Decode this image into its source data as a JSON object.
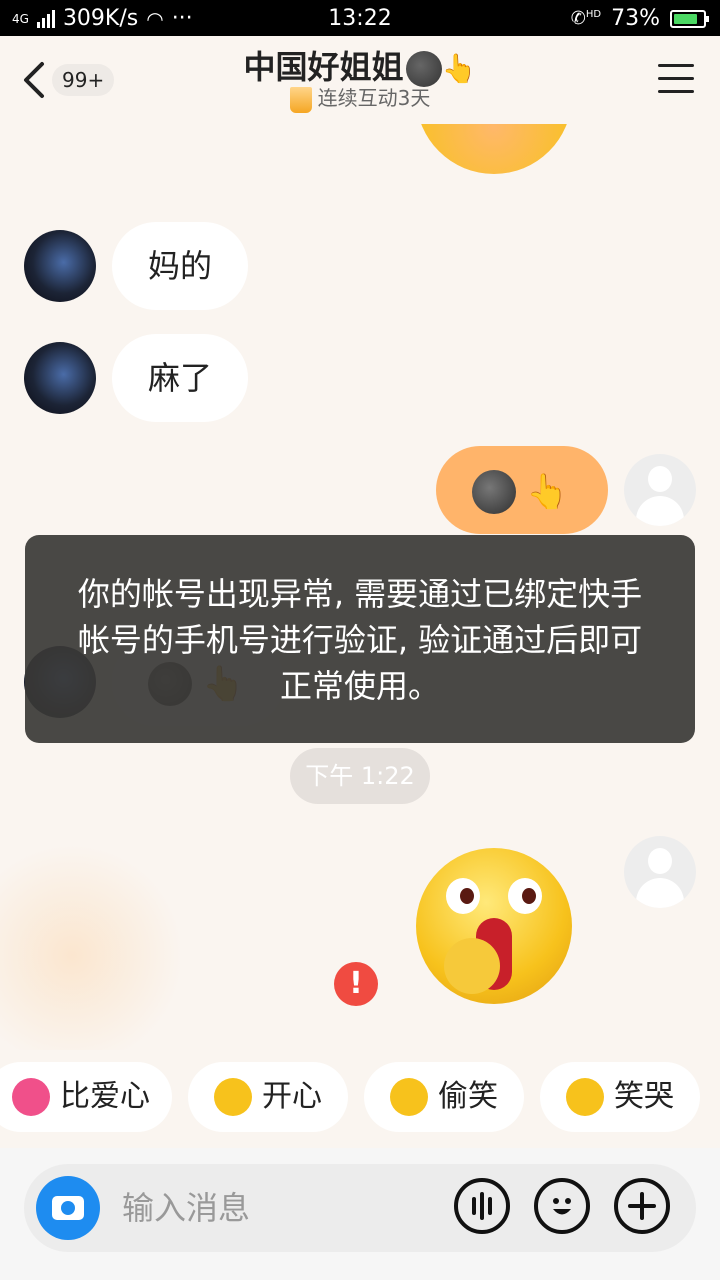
{
  "status_bar": {
    "network": "4G",
    "speed": "309K/s",
    "more": "···",
    "time": "13:22",
    "hd": "HD",
    "battery_percent": "73%",
    "battery_level": 0.73
  },
  "header": {
    "unread_count": "99+",
    "title": "中国好姐姐",
    "title_emoji_hand": "👆",
    "streak_label": "连续互动3天"
  },
  "messages": [
    {
      "sender": "other",
      "text": "妈的"
    },
    {
      "sender": "other",
      "text": "麻了"
    },
    {
      "sender": "me",
      "emoji": [
        "new-moon-face",
        "pointing-up"
      ],
      "hand": "👆"
    },
    {
      "sender": "other",
      "emoji": [
        "new-moon-face",
        "pointing-up"
      ],
      "hand": "👆"
    }
  ],
  "toast": {
    "text": "你的帐号出现异常, 需要通过已绑定快手帐号的手机号进行验证, 验证通过后即可正常使用。"
  },
  "timestamp": "下午 1:22",
  "send_failed_mark": "!",
  "quick_replies": [
    {
      "label": "比爱心",
      "icon": "heart-icon",
      "color": "#f0508a"
    },
    {
      "label": "开心",
      "icon": "laughing-face-icon",
      "color": "#f7c21c"
    },
    {
      "label": "偷笑",
      "icon": "giggle-face-icon",
      "color": "#f7c21c"
    },
    {
      "label": "笑哭",
      "icon": "tears-of-joy-icon",
      "color": "#f7c21c"
    }
  ],
  "input": {
    "placeholder": "输入消息"
  },
  "colors": {
    "background": "#faf5f0",
    "my_bubble": "#ffb46a",
    "camera_button": "#1e8cf0",
    "error": "#f04b41"
  }
}
